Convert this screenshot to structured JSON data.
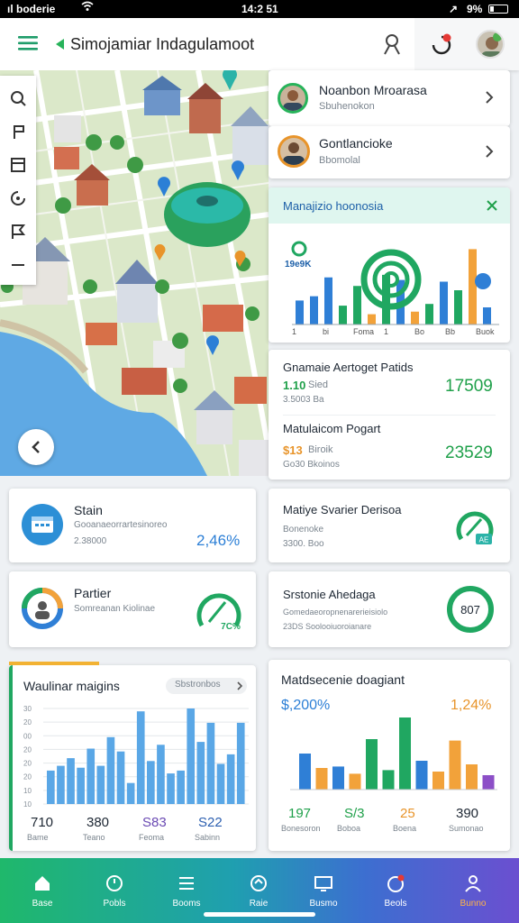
{
  "status_bar": {
    "carrier": "ıl boderie",
    "time": "14:2 51",
    "battery": "9%"
  },
  "app": {
    "title": "Simojamiar Indagulamoot"
  },
  "people": [
    {
      "name": "Noanbon Mroarasa",
      "sub": "Sbuhenokon"
    },
    {
      "name": "Gontlancioke",
      "sub": "Bbomolal"
    }
  ],
  "map_chart": {
    "title": "Manajizio hoonosia",
    "tag": "19e9K",
    "labels": [
      "1",
      "bi",
      "Foma",
      "1",
      "Bo",
      "Bb",
      "Buok"
    ]
  },
  "metric_pair": {
    "first": {
      "title": "Gnamaie Aertoget Patids",
      "value_small": "1.10",
      "suffix": "Sied",
      "sub": "3.5003 Ba",
      "value_big": "17509"
    },
    "second": {
      "title": "Matulaicom Pogart",
      "value_small": "$13",
      "suffix": "Biroik",
      "sub": "Go30 Bkoinos",
      "value_big": "23529"
    }
  },
  "stats": [
    {
      "title": "Stain",
      "sub": "Gooanaeorrartesinoreo",
      "sub2": "2.38000",
      "value": "2,46%"
    },
    {
      "title": "Matiye Svarier Derisoa",
      "sub": "Bonenoke",
      "sub2": "3300. Boo",
      "gauge_label": "AE"
    },
    {
      "title": "Partier",
      "sub": "Somreanan Kiolinae",
      "sub2": "",
      "gauge_label": "7C%"
    },
    {
      "title": "Srstonie Ahedaga",
      "sub": "Gomedaeoropnenarerieisiolo",
      "sub2": "23DS Soolooiuoroianare",
      "ring_value": "807"
    }
  ],
  "chart_left": {
    "title": "Waulinar maigins",
    "dropdown": "Sbstronbos",
    "y_ticks": [
      "30",
      "20",
      "00",
      "20",
      "20",
      "20",
      "10",
      "10"
    ],
    "footer": [
      {
        "value": "710",
        "label": "Bame"
      },
      {
        "value": "380",
        "label": "Teano"
      },
      {
        "value": "S83",
        "label": "Feoma"
      },
      {
        "value": "S22",
        "label": "Sabinn"
      }
    ]
  },
  "chart_right": {
    "title": "Matdsecenie doagiant",
    "left_value": "$,200%",
    "right_value": "1,24%",
    "footer": [
      {
        "value": "197",
        "label": "Bonesoron"
      },
      {
        "value": "S/3",
        "label": "Boboa"
      },
      {
        "value": "25",
        "label": "Boena"
      },
      {
        "value": "390",
        "label": "Sumonao"
      }
    ]
  },
  "chart_data": [
    {
      "type": "bar",
      "title": "Waulinar maigins",
      "series": [
        {
          "values": [
            35,
            40,
            48,
            38,
            58,
            40,
            70,
            55,
            22,
            97,
            45,
            62,
            32,
            35,
            100,
            65,
            85,
            42,
            52,
            85
          ]
        }
      ],
      "ylim": [
        0,
        100
      ],
      "color": "#5aa7e6"
    },
    {
      "type": "bar",
      "title": "Matdsecenie doagiant",
      "series": [
        {
          "values": [
            50,
            30,
            32,
            22,
            70,
            27,
            100,
            40,
            25,
            68,
            35,
            20
          ]
        }
      ],
      "colors": [
        "#2f7fd6",
        "#f2a23a",
        "#2f7fd6",
        "#f2a23a",
        "#20a761",
        "#20a761",
        "#20a761",
        "#2f7fd6",
        "#f2a23a",
        "#f2a23a",
        "#f2a23a",
        "#8c4fc7"
      ],
      "ylim": [
        0,
        100
      ]
    },
    {
      "type": "bar",
      "title": "Manajizio hoonosia",
      "series": [
        {
          "values": [
            28,
            33,
            55,
            22,
            45,
            12,
            58,
            52,
            15,
            24,
            50,
            40,
            88,
            20
          ]
        }
      ],
      "colors": [
        "#2f7fd6",
        "#2f7fd6",
        "#2f7fd6",
        "#20a761",
        "#20a761",
        "#f2a23a",
        "#20a761",
        "#2f7fd6",
        "#f2a23a",
        "#20a761",
        "#2f7fd6",
        "#20a761",
        "#f2a23a",
        "#2f7fd6"
      ],
      "ylim": [
        0,
        100
      ]
    }
  ],
  "colors": {
    "accent_green": "#1fa04a",
    "accent_blue": "#2c7fd6",
    "accent_orange": "#e8942a",
    "nav_start": "#1fb86b",
    "nav_end": "#6b4fd0"
  },
  "nav": [
    {
      "label": "Base",
      "icon": "home-icon"
    },
    {
      "label": "Pobls",
      "icon": "circle-icon"
    },
    {
      "label": "Booms",
      "icon": "list-icon"
    },
    {
      "label": "Raie",
      "icon": "refresh-icon"
    },
    {
      "label": "Busmo",
      "icon": "monitor-icon"
    },
    {
      "label": "Beols",
      "icon": "alert-icon"
    },
    {
      "label": "Bunno",
      "icon": "person-icon"
    }
  ]
}
